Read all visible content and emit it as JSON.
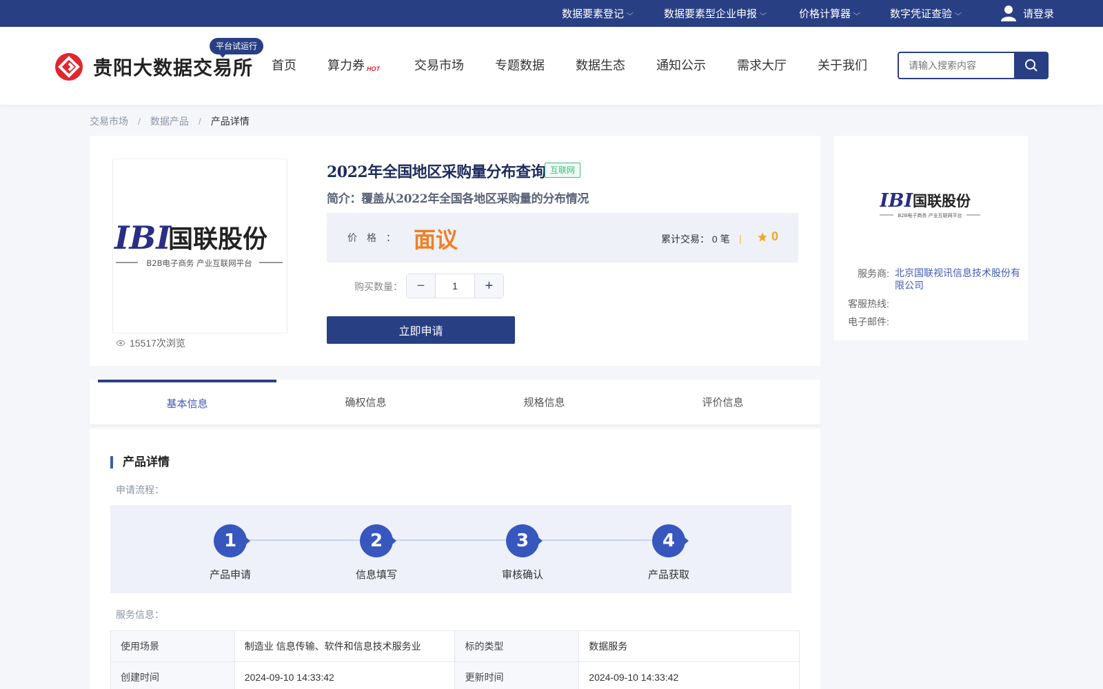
{
  "topbar": {
    "items": [
      "数据要素登记",
      "数据要素型企业申报",
      "价格计算器",
      "数字凭证查验"
    ],
    "login": "请登录"
  },
  "header": {
    "site_name": "贵阳大数据交易所",
    "trial_badge": "平台试运行",
    "nav": [
      "首页",
      "算力券",
      "交易市场",
      "专题数据",
      "数据生态",
      "通知公示",
      "需求大厅",
      "关于我们"
    ],
    "hot_label": "HOT",
    "search_placeholder": "请输入搜索内容"
  },
  "breadcrumb": [
    "交易市场",
    "数据产品",
    "产品详情"
  ],
  "breadcrumb_sep": "/",
  "product": {
    "logo_letters": "IBI",
    "logo_name": "国联股份",
    "logo_tagline": "B2B电子商务 产业互联网平台",
    "title": "2022年全国地区采购量分布查询",
    "tag": "互联网",
    "description": "简介：覆盖从2022年全国各地区采购量的分布情况",
    "price_label": "价格：",
    "price_value": "面议",
    "trade_count": "累计交易： 0 笔",
    "rating": "0",
    "qty_label": "购买数量：",
    "qty_minus": "−",
    "qty_value": "1",
    "qty_plus": "+",
    "apply_button": "立即申请",
    "views": "15517次浏览"
  },
  "provider": {
    "service_label": "服务商:",
    "service_value": "北京国联视讯信息技术股份有限公司",
    "hotline_label": "客服热线:",
    "email_label": "电子邮件:"
  },
  "tabs": [
    "基本信息",
    "确权信息",
    "规格信息",
    "评价信息"
  ],
  "detail": {
    "section_title": "产品详情",
    "flow_label": "申请流程：",
    "steps": [
      {
        "num": "1",
        "name": "产品申请"
      },
      {
        "num": "2",
        "name": "信息填写"
      },
      {
        "num": "3",
        "name": "审核确认"
      },
      {
        "num": "4",
        "name": "产品获取"
      }
    ],
    "service_label": "服务信息：",
    "table": [
      [
        "使用场景",
        "制造业 信息传输、软件和信息技术服务业",
        "标的类型",
        "数据服务"
      ],
      [
        "创建时间",
        "2024-09-10 14:33:42",
        "更新时间",
        "2024-09-10 14:33:42"
      ]
    ]
  },
  "colors": {
    "brand": "#283f83",
    "accent_blue": "#3757bf",
    "price_orange": "#f07f22",
    "tag_green": "#3dbd7d",
    "logo_red": "#e1262e"
  }
}
